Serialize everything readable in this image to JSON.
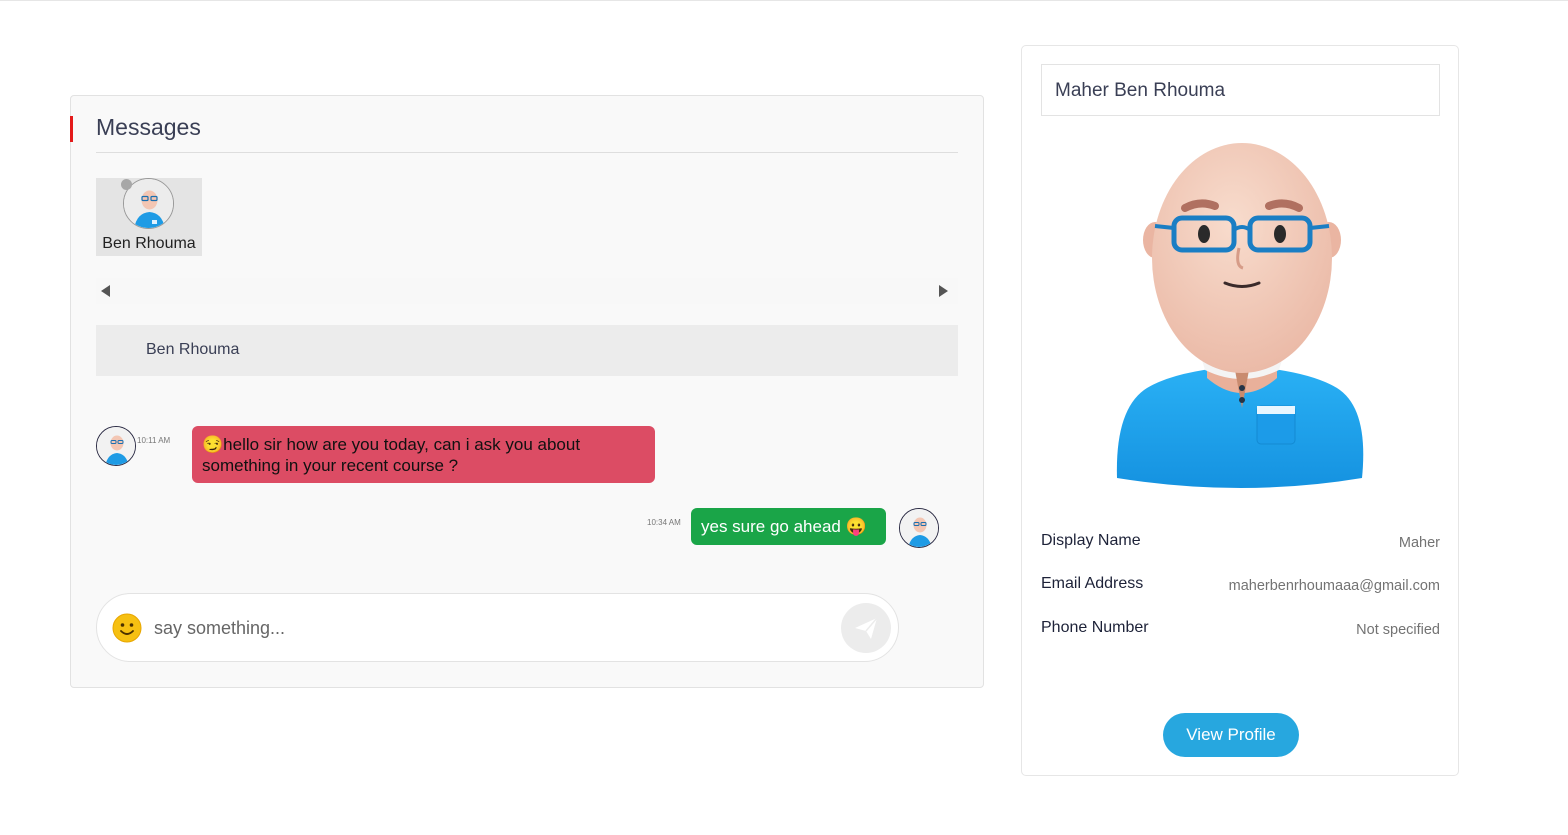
{
  "messages_panel": {
    "title": "Messages",
    "contacts": [
      {
        "name": "Ben Rhouma",
        "status": "offline"
      }
    ],
    "chat_header_name": "Ben Rhouma",
    "conversation": [
      {
        "direction": "incoming",
        "time": "10:11 AM",
        "text": "😏hello sir how are you today, can i ask you about something in your recent course ?"
      },
      {
        "direction": "outgoing",
        "time": "10:34 AM",
        "text": "yes sure go ahead 😛"
      }
    ],
    "composer": {
      "placeholder": "say something...",
      "emoji_icon": "smiley-icon",
      "send_icon": "paper-plane-icon"
    }
  },
  "profile": {
    "full_name": "Maher Ben Rhouma",
    "fields": [
      {
        "label": "Display Name",
        "value": "Maher"
      },
      {
        "label": "Email Address",
        "value": "maherbenrhoumaaa@gmail.com"
      },
      {
        "label": "Phone Number",
        "value": "Not specified"
      }
    ],
    "view_profile_label": "View Profile"
  },
  "colors": {
    "accent_red": "#e41a1a",
    "incoming_bubble": "#dc4c64",
    "outgoing_bubble": "#1aa548",
    "primary_button": "#27a7df"
  }
}
